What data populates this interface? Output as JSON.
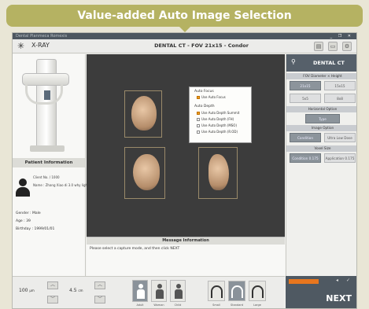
{
  "banner": {
    "title": "Value-added Auto Image Selection"
  },
  "window": {
    "title": "Dental Planmeca Romexis",
    "controls": "_ ❐ ✕"
  },
  "header": {
    "app_name": "X-RAY",
    "mode": "DENTAL CT - FOV 21x15 - Condor",
    "icons": [
      "printer-icon",
      "monitor-icon",
      "settings-icon"
    ]
  },
  "left_panel": {
    "patient_info_title": "Patient Information",
    "patient_id": "Client No. / 1000",
    "patient_name": "Name : Zhang Xiao di 3.0 why lights 0"
  },
  "patient_fields": {
    "gender": "Gender : Male",
    "age": "Age : 39",
    "birthday": "Birthday : 1999/01/01"
  },
  "popup": {
    "focus_title": "Auto Focus",
    "focus_option": "Use Auto Focus",
    "depth_title": "Auto Depth",
    "depth_options": [
      {
        "label": "Use Auto Depth Summit",
        "checked": true
      },
      {
        "label": "Use Auto Depth (FH)",
        "checked": false
      },
      {
        "label": "Use Auto Depth (MSO)",
        "checked": false
      },
      {
        "label": "Use Auto Depth (R.OD)",
        "checked": false
      }
    ]
  },
  "info": {
    "title": "Message Information",
    "message": "Please select a capture mode, and then click NEXT"
  },
  "right_panel": {
    "title": "DENTAL CT",
    "fov_section": "FOV Diameter × Height",
    "fov_options": [
      "21x15",
      "15x15",
      "5x5",
      "8x8"
    ],
    "horizontal_section": "Horizontal Option",
    "horizontal_option": "Type",
    "image_option_section": "Image Option",
    "image_options": [
      "Condition",
      "Ultra Low Dose"
    ],
    "voxel_section": "Voxel Size",
    "voxel_options": [
      "Condition 0.175",
      "Application 0.175"
    ]
  },
  "bottom_bar": {
    "thickness": {
      "value": "100",
      "unit": "µm"
    },
    "layer": {
      "value": "4.5",
      "unit": "cm"
    },
    "pose_labels": [
      "Adult",
      "Woman",
      "Child"
    ],
    "arch_labels": [
      "Small",
      "Standard",
      "Large"
    ]
  },
  "next_button": {
    "label": "NEXT"
  },
  "colors": {
    "banner": "#b5b262",
    "accent": "#e8761e",
    "panel_dark": "#56606a"
  }
}
